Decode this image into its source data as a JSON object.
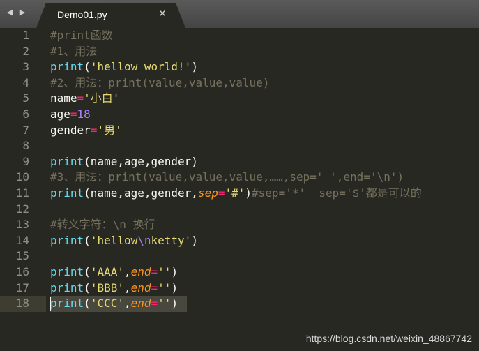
{
  "tabbar": {
    "back_arrow": "◀",
    "forward_arrow": "▶",
    "tab_title": "Demo01.py",
    "close_glyph": "✕"
  },
  "gutter": [
    "1",
    "2",
    "3",
    "4",
    "5",
    "6",
    "7",
    "8",
    "9",
    "10",
    "11",
    "12",
    "13",
    "14",
    "15",
    "16",
    "17",
    "18"
  ],
  "code": {
    "l1": {
      "c": "#print函数"
    },
    "l2": {
      "c": "#1、用法"
    },
    "l3": {
      "f": "print",
      "p1": "(",
      "s": "'hellow world!'",
      "p2": ")"
    },
    "l4": {
      "c": "#2、用法：print(value,value,value)"
    },
    "l5": {
      "n": "name",
      "o": "=",
      "s": "'小白'"
    },
    "l6": {
      "n": "age",
      "o": "=",
      "v": "18"
    },
    "l7": {
      "n": "gender",
      "o": "=",
      "s": "'男'"
    },
    "l9": {
      "f": "print",
      "a": "(name,age,gender)"
    },
    "l10": {
      "c": "#3、用法：print(value,value,value,……,sep=' ',end='\\n')"
    },
    "l11": {
      "f": "print",
      "a": "(name,age,gender,",
      "k": "sep",
      "o": "=",
      "s": "'#'",
      "p": ")",
      "c": "#sep='*'  sep='$'都是可以的"
    },
    "l13": {
      "c": "#转义字符：\\n 换行"
    },
    "l14": {
      "f": "print",
      "p1": "(",
      "s1": "'hellow",
      "e": "\\n",
      "s2": "ketty'",
      "p2": ")"
    },
    "l16": {
      "f": "print",
      "p1": "(",
      "s": "'AAA'",
      "m": ",",
      "k": "end",
      "o": "=",
      "s2": "''",
      "p2": ")"
    },
    "l17": {
      "f": "print",
      "p1": "(",
      "s": "'BBB'",
      "m": ",",
      "k": "end",
      "o": "=",
      "s2": "''",
      "p2": ")"
    },
    "l18": {
      "f": "print",
      "p1": "(",
      "s": "'CCC'",
      "m": ",",
      "k": "end",
      "o": "=",
      "s2": "''",
      "p2": ")"
    }
  },
  "watermark": "https://blog.csdn.net/weixin_48867742",
  "colors": {
    "background": "#272822",
    "comment": "#75715e",
    "function": "#66d9ef",
    "string": "#e6db74",
    "operator": "#f92672",
    "number": "#ae81ff",
    "parameter": "#fd971f",
    "text": "#f8f8f2"
  }
}
